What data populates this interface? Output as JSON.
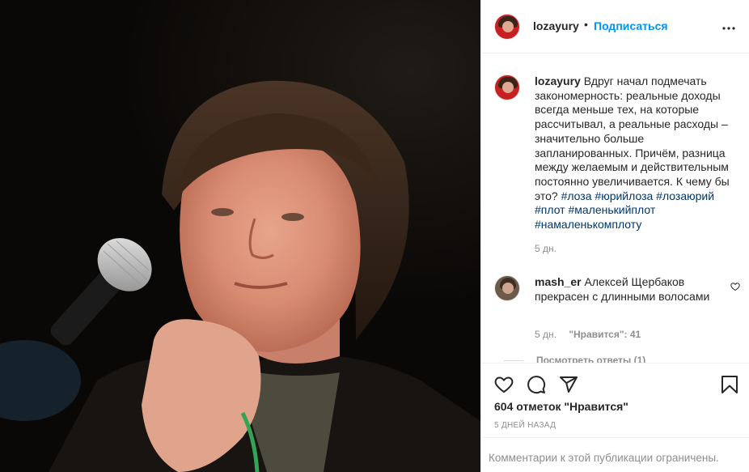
{
  "post": {
    "author": "lozayury",
    "follow_label": "Подписаться",
    "separator": "•",
    "more_label": "•••",
    "caption_text": "Вдруг начал подмечать закономерность: реальные доходы всегда меньше тех, на которые рассчитывал, а реальные расходы – значительно больше запланированных. Причём, разница между желаемым и действительным постоянно увеличивается. К чему бы это?",
    "hashtags": [
      "#лоза",
      "#юрийлоза",
      "#лозаюрий",
      "#плот",
      "#маленькийплот",
      "#намаленькомплоту"
    ],
    "caption_time": "5 дн.",
    "likes_label": "604 отметок \"Нравится\"",
    "posted_ago": "5 ДНЕЙ НАЗАД",
    "comments_limited": "Комментарии к этой публикации ограничены."
  },
  "comment": {
    "author": "mash_er",
    "text": "Алексей Щербаков прекрасен с длинными волосами",
    "time": "5 дн.",
    "likes": "\"Нравится\": 41",
    "view_replies": "Посмотреть ответы (1)"
  },
  "icons": {
    "like": "heart-icon",
    "comment": "comment-icon",
    "share": "paper-plane-icon",
    "save": "bookmark-icon",
    "more": "more-dots-icon",
    "comment_like": "heart-icon"
  }
}
